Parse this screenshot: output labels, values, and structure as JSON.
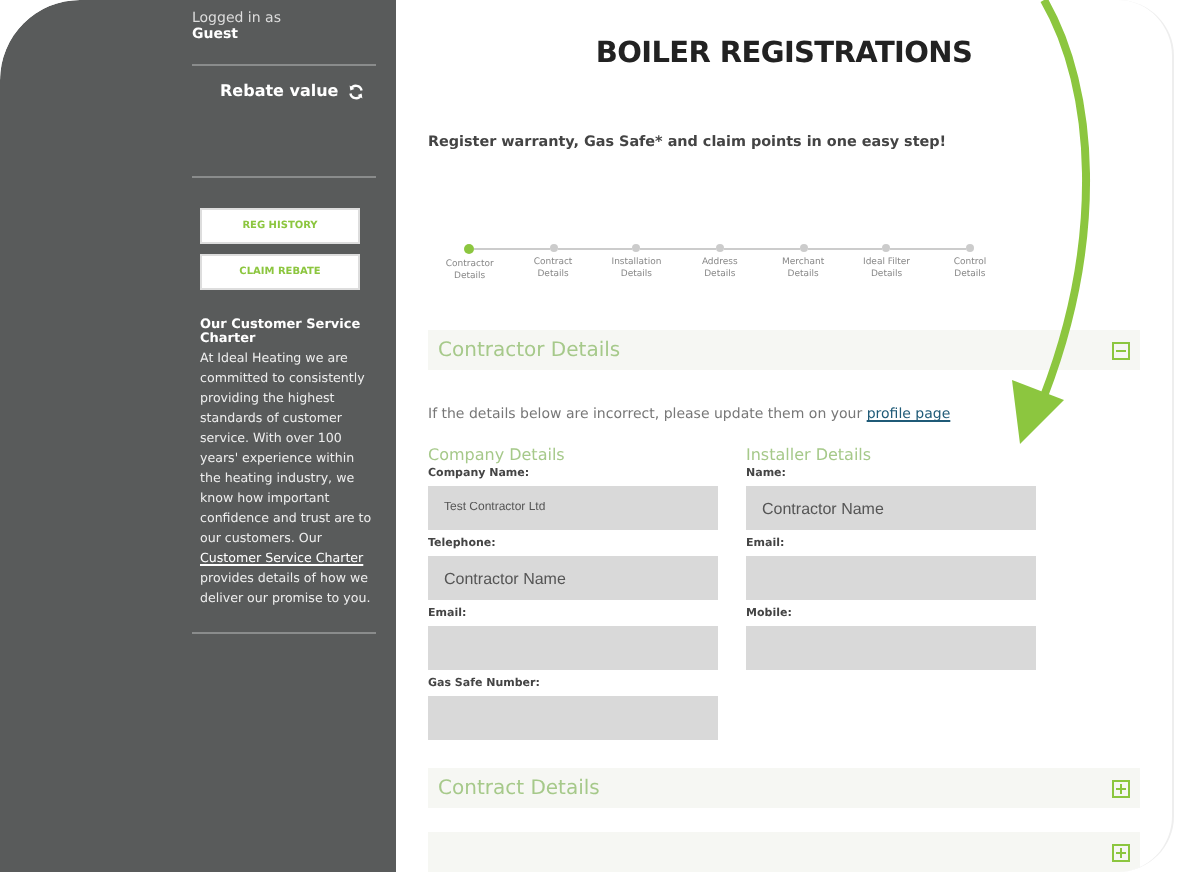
{
  "sidebar": {
    "logged_in_label": "Logged in as",
    "user": "Guest",
    "rebate_label": "Rebate value",
    "buttons": [
      "REG HISTORY",
      "CLAIM REBATE"
    ],
    "charter": {
      "title": "Our Customer Service Charter",
      "text_before": "At Ideal Heating we are committed to consistently providing the highest standards of customer service. With over 100 years' experience within the heating industry, we know how important confidence and trust are to our customers. Our ",
      "link": "Customer Service Charter",
      "text_after": " provides details of how we deliver our promise to you."
    }
  },
  "main": {
    "title": "BOILER REGISTRATIONS",
    "subtitle": "Register warranty, Gas Safe* and claim points in one easy step!",
    "steps": [
      {
        "label": "Contractor Details",
        "selected": true
      },
      {
        "label": "Contract Details",
        "selected": false
      },
      {
        "label": "Installation Details",
        "selected": false
      },
      {
        "label": "Address Details",
        "selected": false
      },
      {
        "label": "Merchant Details",
        "selected": false
      },
      {
        "label": "Ideal Filter Details",
        "selected": false
      },
      {
        "label": "Control Details",
        "selected": false
      }
    ],
    "sections": [
      {
        "title": "Contractor Details",
        "expanded": true,
        "info": "If the details below are incorrect, please update them on your ",
        "info_link": "profile page",
        "columns": [
          {
            "heading": "Company Details",
            "fields": [
              {
                "label": "Company Name:",
                "value": "Test Contractor Ltd",
                "small": true
              },
              {
                "label": "Telephone:",
                "value": "Contractor Name"
              },
              {
                "label": "Email:"
              },
              {
                "label": "Gas Safe Number:"
              }
            ]
          },
          {
            "heading": "Installer Details",
            "fields": [
              {
                "label": "Name:",
                "value": "Contractor Name"
              },
              {
                "label": "Email:"
              },
              {
                "label": "Mobile:"
              }
            ]
          }
        ]
      },
      {
        "title": "Contract Details",
        "expanded": false
      },
      {
        "expanded": false
      }
    ]
  }
}
